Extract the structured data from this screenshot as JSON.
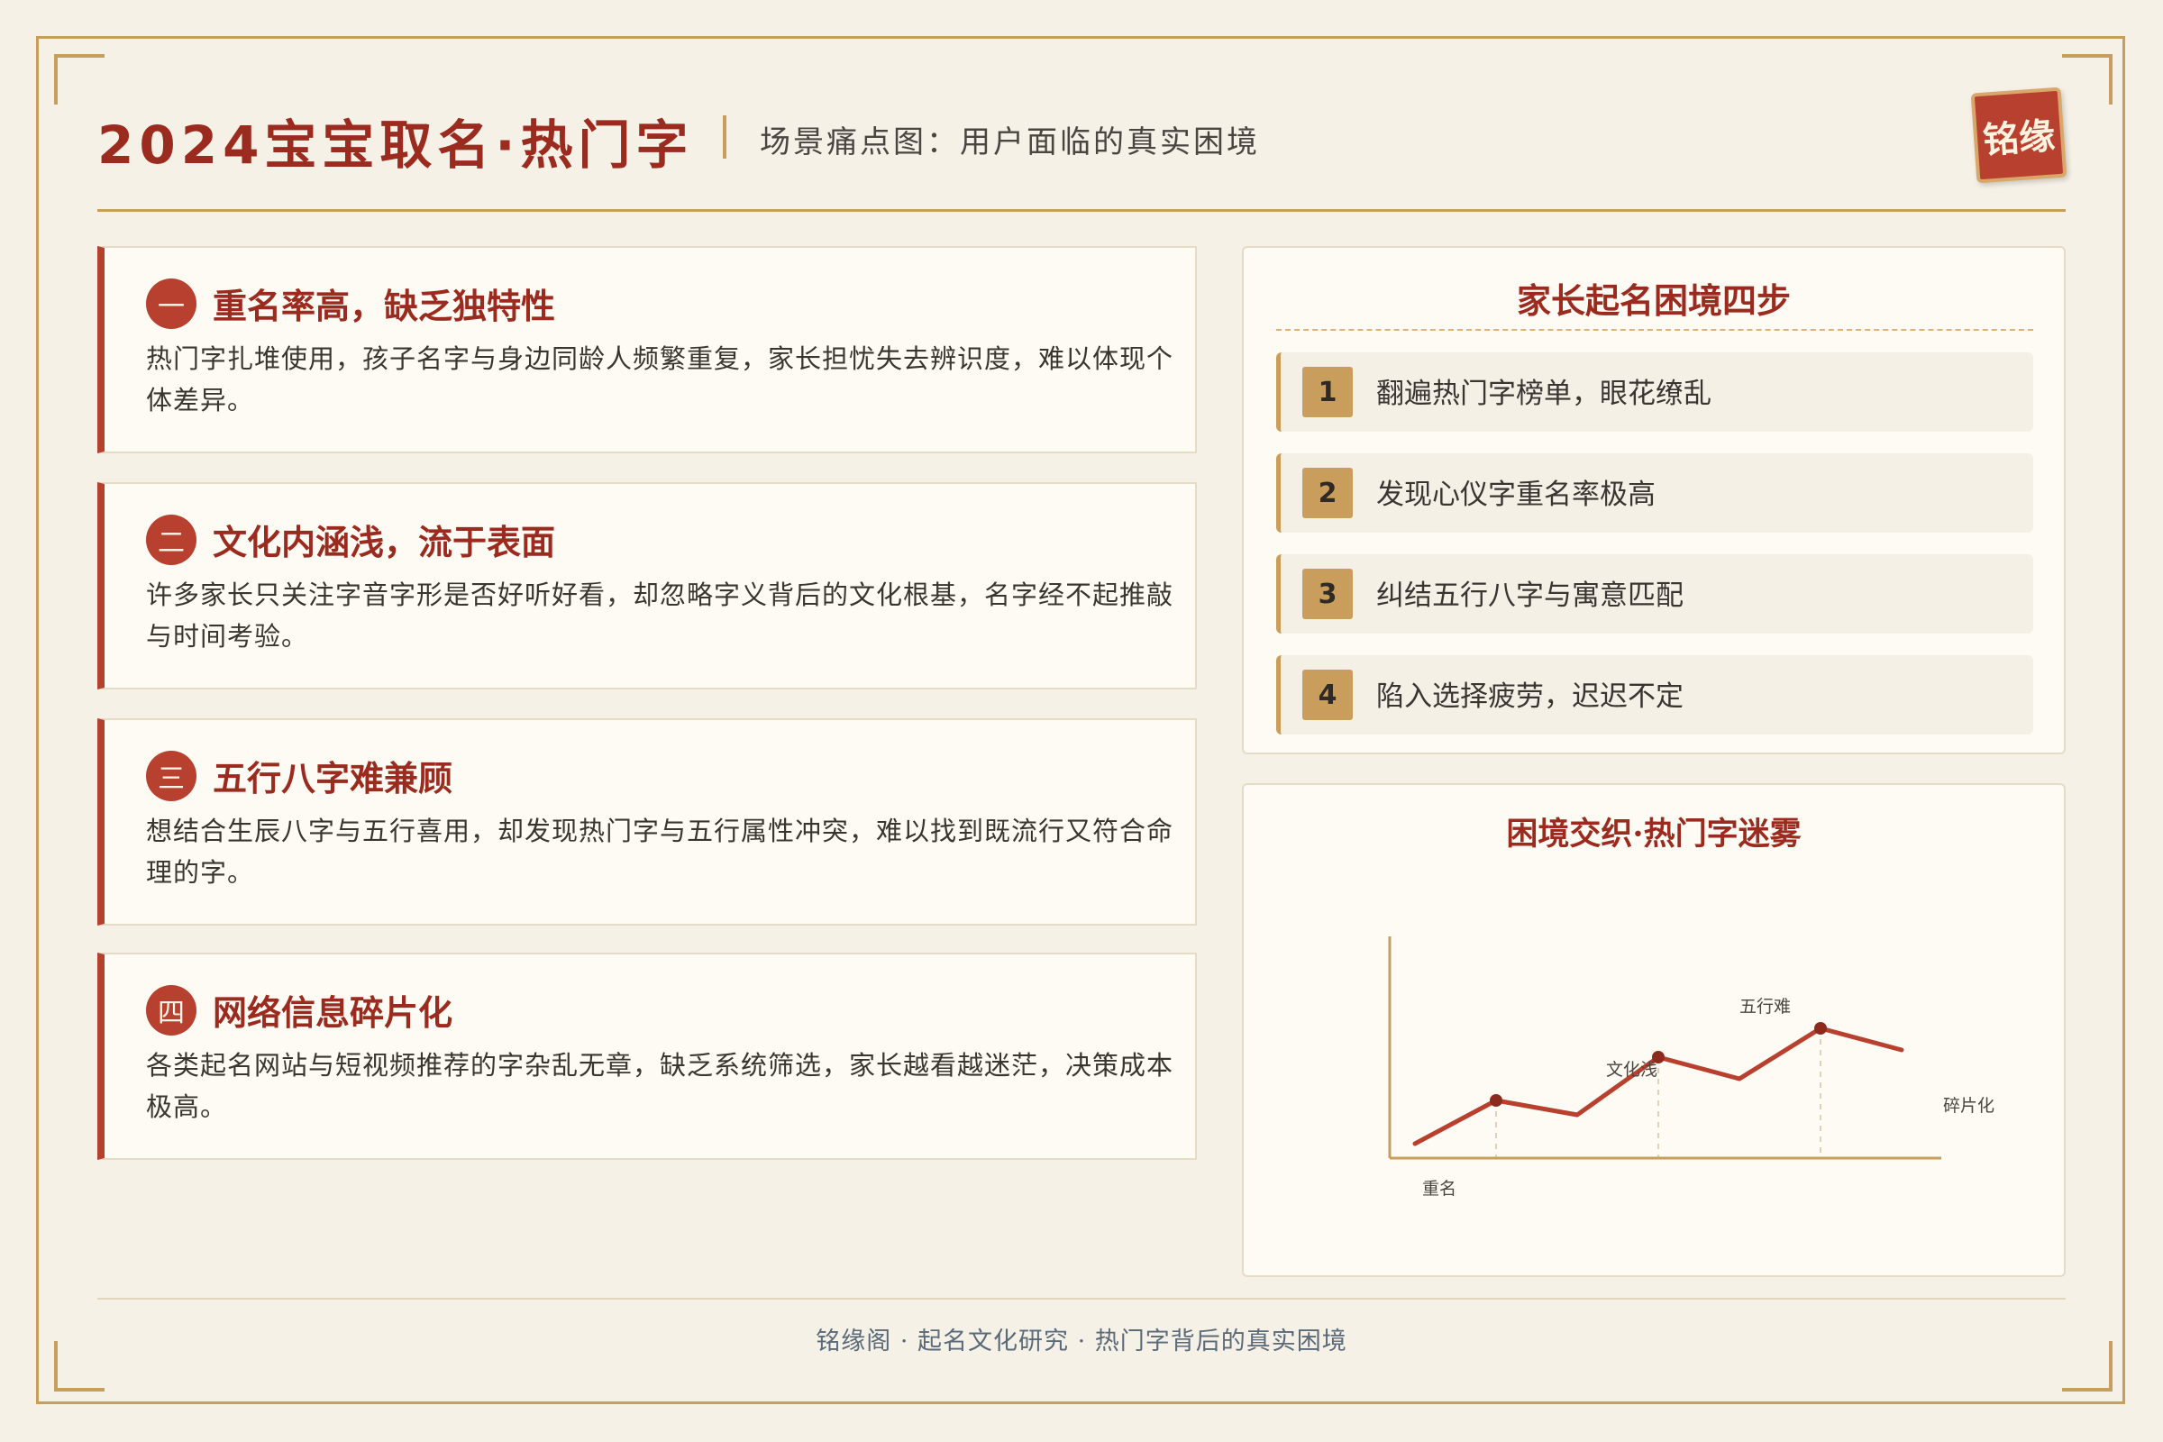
{
  "header": {
    "title": "2024宝宝取名·热门字",
    "subtitle": "场景痛点图：用户面临的真实困境",
    "seal": "铭缘"
  },
  "pain_points": [
    {
      "badge": "一",
      "title": "重名率高，缺乏独特性",
      "body": "热门字扎堆使用，孩子名字与身边同龄人频繁重复，家长担忧失去辨识度，难以体现个体差异。"
    },
    {
      "badge": "二",
      "title": "文化内涵浅，流于表面",
      "body": "许多家长只关注字音字形是否好听好看，却忽略字义背后的文化根基，名字经不起推敲与时间考验。"
    },
    {
      "badge": "三",
      "title": "五行八字难兼顾",
      "body": "想结合生辰八字与五行喜用，却发现热门字与五行属性冲突，难以找到既流行又符合命理的字。"
    },
    {
      "badge": "四",
      "title": "网络信息碎片化",
      "body": "各类起名网站与短视频推荐的字杂乱无章，缺乏系统筛选，家长越看越迷茫，决策成本极高。"
    }
  ],
  "steps_panel": {
    "title": "家长起名困境四步",
    "steps": [
      {
        "num": "1",
        "text": "翻遍热门字榜单，眼花缭乱"
      },
      {
        "num": "2",
        "text": "发现心仪字重名率极高"
      },
      {
        "num": "3",
        "text": "纠结五行八字与寓意匹配"
      },
      {
        "num": "4",
        "text": "陷入选择疲劳，迟迟不定"
      }
    ]
  },
  "chart_data": {
    "type": "line",
    "title": "困境交织·热门字迷雾",
    "x": [
      0,
      1,
      2,
      3,
      4,
      5,
      6
    ],
    "series": [
      {
        "values": [
          1,
          4,
          3,
          7,
          5.5,
          9,
          7.5
        ]
      }
    ],
    "ylim": [
      0,
      10
    ],
    "annotations": [
      {
        "x": 0.3,
        "text": "重名"
      },
      {
        "x": 3,
        "text": "文化浅"
      },
      {
        "x": 5,
        "text": "五行难"
      },
      {
        "x": 6,
        "text": "碎片化"
      }
    ],
    "markers_at": [
      1,
      3,
      5
    ],
    "line_color": "#b8402e",
    "axis_color": "#c99d5c"
  },
  "footer": {
    "text": "铭缘阁 · 起名文化研究 · 热门字背后的真实困境"
  },
  "colors": {
    "accent": "#9b2a1f",
    "seal": "#b8402e",
    "gold": "#c99d5c",
    "background": "#f5f1e7"
  }
}
